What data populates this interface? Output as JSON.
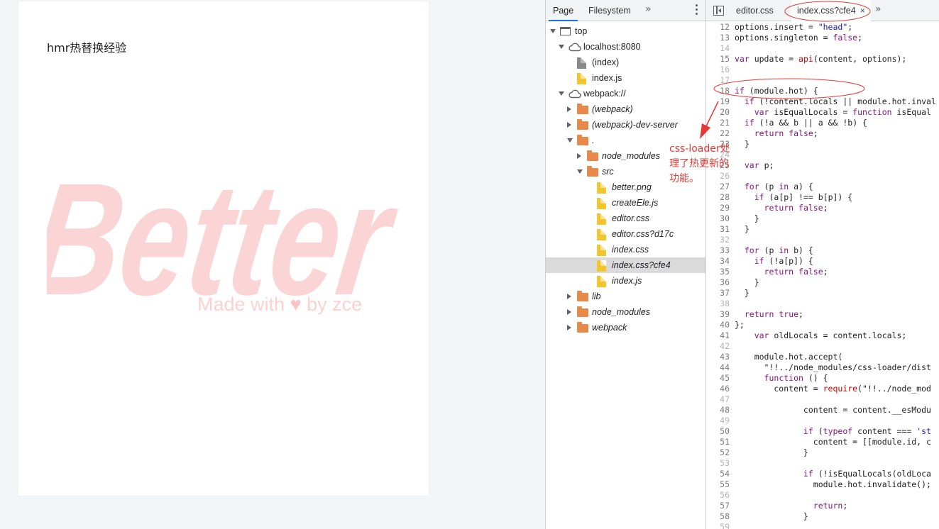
{
  "page": {
    "title": "hmr热替换经验",
    "logo_text": "Better",
    "made_with_prefix": "Made with",
    "heart": "♥",
    "made_with_suffix": "by zce"
  },
  "devtools": {
    "nav_tabs": [
      "Page",
      "Filesystem"
    ],
    "more_tabs_icon": "»",
    "tree": [
      {
        "label": "top",
        "icon": "frame-icon",
        "expanded": true,
        "italic": false
      },
      {
        "label": "localhost:8080",
        "icon": "cloud-icon",
        "expanded": true,
        "italic": false
      },
      {
        "label": "(index)",
        "icon": "file-icon",
        "italic": false
      },
      {
        "label": "index.js",
        "icon": "js-file-icon",
        "italic": false
      },
      {
        "label": "webpack://",
        "icon": "cloud-icon",
        "expanded": true,
        "italic": false
      },
      {
        "label": "(webpack)",
        "icon": "folder-icon",
        "expanded": false,
        "italic": true
      },
      {
        "label": "(webpack)-dev-server",
        "icon": "folder-icon",
        "expanded": false,
        "italic": true
      },
      {
        "label": ".",
        "icon": "folder-icon",
        "expanded": true,
        "italic": true
      },
      {
        "label": "node_modules",
        "icon": "folder-icon",
        "expanded": false,
        "italic": true
      },
      {
        "label": "src",
        "icon": "folder-icon",
        "expanded": true,
        "italic": true
      },
      {
        "label": "better.png",
        "icon": "js-file-icon",
        "italic": true
      },
      {
        "label": "createEle.js",
        "icon": "js-file-icon",
        "italic": true
      },
      {
        "label": "editor.css",
        "icon": "js-file-icon",
        "italic": true
      },
      {
        "label": "editor.css?d17c",
        "icon": "js-file-icon",
        "italic": true
      },
      {
        "label": "index.css",
        "icon": "js-file-icon",
        "italic": true
      },
      {
        "label": "index.css?cfe4",
        "icon": "js-file-icon",
        "italic": true,
        "selected": true
      },
      {
        "label": "index.js",
        "icon": "js-file-icon",
        "italic": true
      },
      {
        "label": "lib",
        "icon": "folder-icon",
        "expanded": false,
        "italic": true
      },
      {
        "label": "node_modules",
        "icon": "folder-icon",
        "expanded": false,
        "italic": true
      },
      {
        "label": "webpack",
        "icon": "folder-icon",
        "expanded": false,
        "italic": true
      }
    ],
    "editor_tabs": [
      {
        "label": "editor.css",
        "active": false
      },
      {
        "label": "index.css?cfe4",
        "active": true,
        "close": "×"
      }
    ],
    "code": [
      {
        "n": "12",
        "t": "options.insert = \"head\";"
      },
      {
        "n": "13",
        "t": "options.singleton = false;"
      },
      {
        "n": "14",
        "t": ""
      },
      {
        "n": "15",
        "t": "var update = api(content, options);"
      },
      {
        "n": "16",
        "t": ""
      },
      {
        "n": "17",
        "t": ""
      },
      {
        "n": "18",
        "t": "if (module.hot) {"
      },
      {
        "n": "19",
        "t": "  if (!content.locals || module.hot.inval"
      },
      {
        "n": "20",
        "t": "    var isEqualLocals = function isEqual"
      },
      {
        "n": "21",
        "t": "  if (!a && b || a && !b) {"
      },
      {
        "n": "22",
        "t": "    return false;"
      },
      {
        "n": "23",
        "t": "  }"
      },
      {
        "n": "24",
        "t": ""
      },
      {
        "n": "25",
        "t": "  var p;"
      },
      {
        "n": "26",
        "t": ""
      },
      {
        "n": "27",
        "t": "  for (p in a) {"
      },
      {
        "n": "28",
        "t": "    if (a[p] !== b[p]) {"
      },
      {
        "n": "29",
        "t": "      return false;"
      },
      {
        "n": "30",
        "t": "    }"
      },
      {
        "n": "31",
        "t": "  }"
      },
      {
        "n": "32",
        "t": ""
      },
      {
        "n": "33",
        "t": "  for (p in b) {"
      },
      {
        "n": "34",
        "t": "    if (!a[p]) {"
      },
      {
        "n": "35",
        "t": "      return false;"
      },
      {
        "n": "36",
        "t": "    }"
      },
      {
        "n": "37",
        "t": "  }"
      },
      {
        "n": "38",
        "t": ""
      },
      {
        "n": "39",
        "t": "  return true;"
      },
      {
        "n": "40",
        "t": "};"
      },
      {
        "n": "41",
        "t": "    var oldLocals = content.locals;"
      },
      {
        "n": "42",
        "t": ""
      },
      {
        "n": "43",
        "t": "    module.hot.accept("
      },
      {
        "n": "44",
        "t": "      \"!!../node_modules/css-loader/dist"
      },
      {
        "n": "45",
        "t": "      function () {"
      },
      {
        "n": "46",
        "t": "        content = require(\"!!../node_mod"
      },
      {
        "n": "47",
        "t": ""
      },
      {
        "n": "48",
        "t": "              content = content.__esModu"
      },
      {
        "n": "49",
        "t": ""
      },
      {
        "n": "50",
        "t": "              if (typeof content === 'st"
      },
      {
        "n": "51",
        "t": "                content = [[module.id, c"
      },
      {
        "n": "52",
        "t": "              }"
      },
      {
        "n": "53",
        "t": ""
      },
      {
        "n": "54",
        "t": "              if (!isEqualLocals(oldLoca"
      },
      {
        "n": "55",
        "t": "                module.hot.invalidate();"
      },
      {
        "n": "56",
        "t": ""
      },
      {
        "n": "57",
        "t": "                return;"
      },
      {
        "n": "58",
        "t": "              }"
      },
      {
        "n": "59",
        "t": ""
      }
    ]
  },
  "annotation": {
    "lines": [
      "css-loader处",
      "理了热更新的",
      "功能。"
    ],
    "color": "#e53935"
  }
}
